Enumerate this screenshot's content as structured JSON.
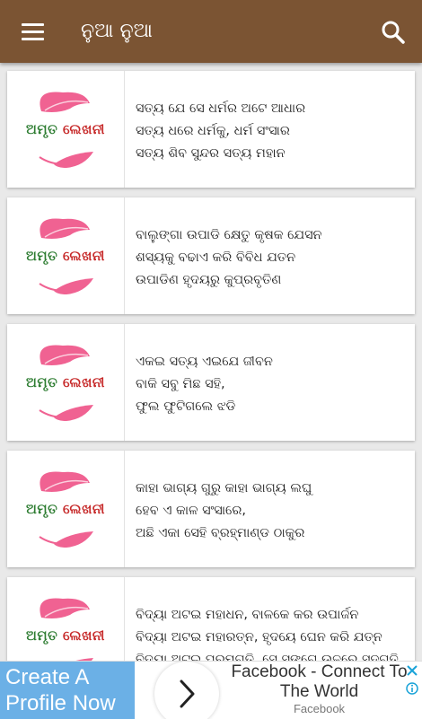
{
  "appbar": {
    "title": "ନୁଆ ନୁଆ",
    "menu_icon": "hamburger-menu-icon",
    "search_icon": "search-icon"
  },
  "colors": {
    "appbar": "#7b5433",
    "background": "#e9e9e9",
    "logo_green": "#2e7d32",
    "logo_red": "#c62828",
    "feather_pink": "#f06292"
  },
  "logo": {
    "word1": "ଅମୃତ",
    "word2": "ଲେଖନୀ"
  },
  "posts": [
    {
      "lines": [
        "ସତ୍ୟ ଯେ ସେ ଧର୍ମର ଅଟେ ଆଧାର",
        "ସତ୍ୟ ଧରେ ଧର୍ମକୁ, ଧର୍ମ ସଂସାର",
        "ସତ୍ୟ ଶିବ ସୁନ୍ଦର ସତ୍ୟ ମହାନ"
      ]
    },
    {
      "lines": [
        "ବାଲୁଙ୍ଗା ଉପାଡି କ୍ଷେତୁ  କୃଷକ ଯେସନ",
        "ଶସ୍ୟକୁ ବଢାଏ କରି ବିବିଧ ଯତନ",
        "ଉପାଡିଣ ହୃଦୟରୁ କୁପ୍ରବୃତିଣ"
      ]
    },
    {
      "lines": [
        "ଏକଇ ସତ୍ୟ ଏଇଯେ ଜୀବନ",
        "ବାକି ସବୁ ମିଛ ସହି,",
        "ଫୁଲ ଫୁଟିଗଲେ ଝଡି"
      ]
    },
    {
      "lines": [
        "କାହା ଭାଗ୍ୟ ଗୁରୁ କାହା ଭାଗ୍ୟ ଲଘୁ",
        "ହେବ ଏ କାଳ ସଂସାରେ,",
        "ଅଛି ଏକା ସେହି ବ୍ରହ୍ମାଣ୍ଡ ଠାକୁର"
      ]
    },
    {
      "lines": [
        "ବିଦ୍ୟା ଅଟଇ ମହାଧନ, ବାଳକେ କର ଉପାର୍ଜନ",
        "ବିଦ୍ୟା ଅଟଇ ମହାରତ୍ନ, ହୃଦୟେ ଘେନ କରି ଯତ୍ନ",
        "ବିଦ୍ୟା ଅଟଇ ପରମଗତି, ସେ ସଙ୍ଗେ ଉଚ୍ଚରେ ସଦ୍ଗତି"
      ]
    }
  ],
  "ad": {
    "left_line1": "Create A",
    "left_line2": "Profile Now",
    "title_line1": "Facebook - Connect To",
    "title_line2": "The World",
    "source": "Facebook",
    "arrow_icon": "chevron-right-icon",
    "close_icon": "close-icon",
    "info_icon": "info-icon"
  }
}
